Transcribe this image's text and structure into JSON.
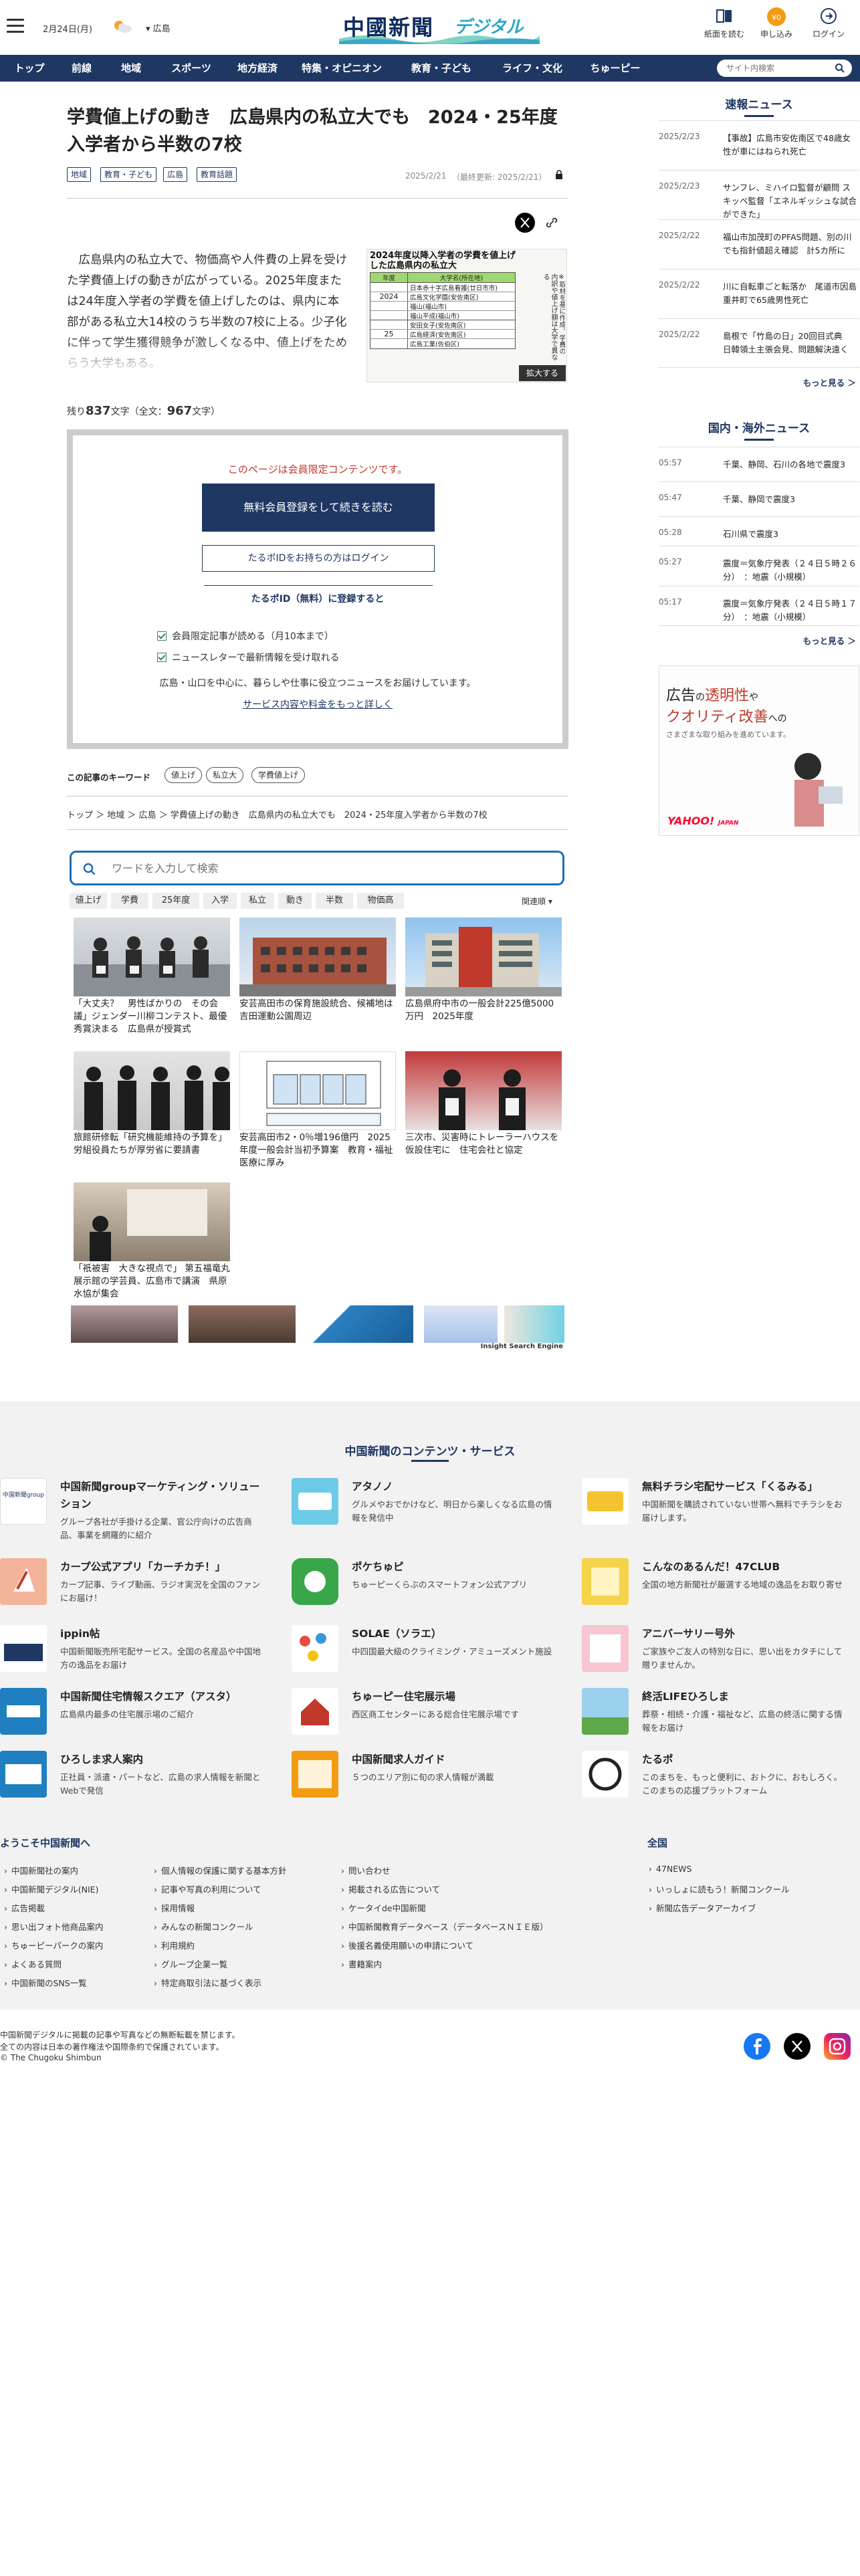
{
  "header": {
    "date": "2月24日(月)",
    "region": "広島",
    "logo_main": "中國新聞",
    "logo_sub": "デジタル",
    "icons": [
      {
        "label": "紙面を読む",
        "icon": "newspaper-icon"
      },
      {
        "label": "申し込み",
        "icon": "apply-badge-icon"
      },
      {
        "label": "ログイン",
        "icon": "login-icon"
      }
    ]
  },
  "nav": {
    "items": [
      "トップ",
      "前線",
      "地域",
      "スポーツ",
      "地方経済",
      "特集・オピニオン",
      "教育・子ども",
      "ライフ・文化",
      "ちゅーピー"
    ],
    "search_placeholder": "サイト内検索"
  },
  "article": {
    "title": "学費値上げの動き　広島県内の私立大でも　2024・25年度入学者から半数の7校",
    "tags": [
      "地域",
      "教育・子ども",
      "広島",
      "教育話題"
    ],
    "date": "2025/2/21",
    "updated": "（最終更新: 2025/2/21）",
    "body": "広島県内の私立大で、物価高や人件費の上昇を受けた学費値上げの動きが広がっている。2025年度または24年度入学者の学費を値上げしたのは、県内に本部がある私立大14校のうち半数の7校に上る。少子化に伴って学生獲得競争が激しくなる中、値上げをためらう大学もある。",
    "remaining_prefix": "残り",
    "remaining_count": "837",
    "remaining_mid": "文字（全文：",
    "total_count": "967",
    "remaining_suffix": "文字）",
    "figure": {
      "title": "2024年度以降入学者の学費を値上げした広島県内の私立大",
      "col_year": "年度",
      "col_univ": "大学名(所在地)",
      "rows": [
        {
          "year": "",
          "univ": "日本赤十字広島看護(廿日市市)"
        },
        {
          "year": "2024",
          "univ": "広島文化学園(安佐南区)"
        },
        {
          "year": "",
          "univ": "福山(福山市)"
        },
        {
          "year": "",
          "univ": "福山平成(福山市)"
        },
        {
          "year": "",
          "univ": "安田女子(安佐南区)"
        },
        {
          "year": "25",
          "univ": "広島経済(安佐南区)"
        },
        {
          "year": "",
          "univ": "広島工業(佐伯区)"
        }
      ],
      "side_note": "※取材を基に作成。学費の内訳や値上げ額は大学で異なる",
      "zoom_label": "拡大する"
    }
  },
  "paywall": {
    "message": "このページは会員限定コンテンツです。",
    "free_button": "無料会員登録をして続きを読む",
    "login_button": "たるポIDをお持ちの方はログイン",
    "register_heading": "たるポID（無料）に登録すると",
    "benefits": [
      "会員限定記事が読める（月10本まで）",
      "ニュースレターで最新情報を受け取れる"
    ],
    "news_line": "広島・山口を中心に、暮らしや仕事に役立つニュースをお届けしています。",
    "more_link": "サービス内容や料金をもっと詳しく"
  },
  "keywords": {
    "label": "この記事のキーワード",
    "items": [
      "値上げ",
      "私立大",
      "学費値上げ"
    ]
  },
  "breadcrumb": "トップ ＞ 地域 ＞ 広島 ＞ 学費値上げの動き　広島県内の私立大でも　2024・25年度入学者から半数の7校",
  "ise": {
    "placeholder": "ワードを入力して検索",
    "word_tabs": [
      "値上げ",
      "学費",
      "25年度",
      "入学",
      "私立",
      "動き",
      "半数",
      "物価高"
    ],
    "sort_label": "関連順",
    "cards": [
      {
        "caption": "「大丈夫？　男性ばかりの　その会議」ジェンダー川柳コンテスト、最優秀賞決まる　広島県が授賞式"
      },
      {
        "caption": "安芸高田市の保育施設統合、候補地は吉田運動公園周辺"
      },
      {
        "caption": "広島県府中市の一般会計225億5000万円　2025年度"
      },
      {
        "caption": "旅館研修転「研究機能維持の予算を」 労組役員たちが厚労省に要請書"
      },
      {
        "caption": "安芸高田市2・0％増196億円　2025年度一般会計当初予算案　教育・福祉医療に厚み"
      },
      {
        "caption": "三次市、災害時にトレーラーハウスを仮設住宅に　住宅会社と協定"
      },
      {
        "caption": "「祇被害　大きな視点で」 第五福竜丸展示館の学芸員、広島市で講演　県原水協が集会"
      }
    ],
    "engine_label": "Insight Search Engine"
  },
  "sokuhou": {
    "heading": "速報ニュース",
    "items": [
      {
        "date": "2025/2/23",
        "title": "【事故】広島市安佐南区で48歳女性が車にはねられ死亡"
      },
      {
        "date": "2025/2/23",
        "title": "サンフレ、ミハイロ監督が顧問 スキッベ監督「エネルギッシュな試合ができた」"
      },
      {
        "date": "2025/2/22",
        "title": "福山市加茂町のPFAS問題、別の川でも指針値超え確認　計5カ所に"
      },
      {
        "date": "2025/2/22",
        "title": "川に自転車ごと転落か　尾道市因島重井町で65歳男性死亡"
      },
      {
        "date": "2025/2/22",
        "title": "島根で「竹島の日」20回目式典　日韓領土主張会見、問題解決遠く"
      }
    ],
    "more": "もっと見る ＞"
  },
  "kokunai": {
    "heading": "国内・海外ニュース",
    "items": [
      {
        "time": "05:57",
        "title": "千葉、静岡、石川の各地で震度3"
      },
      {
        "time": "05:47",
        "title": "千葉、静岡で震度3"
      },
      {
        "time": "05:28",
        "title": "石川県で震度3"
      },
      {
        "time": "05:27",
        "title": "震度＝気象庁発表（２４日５時２６分）　：地震（小規模）"
      },
      {
        "time": "05:17",
        "title": "震度＝気象庁発表（２４日５時１７分）　：地震（小規模）"
      }
    ],
    "more": "もっと見る ＞"
  },
  "ad": {
    "line1a": "広告",
    "line1b": "の",
    "line1c": "透明性",
    "line1d": "や",
    "line2a": "クオリティ改善",
    "line2b": "への",
    "line3": "さまざまな取り組みを進めています。",
    "brand": "YAHOO!",
    "brand_sub": "JAPAN"
  },
  "services": {
    "heading": "中国新聞のコンテンツ・サービス",
    "items": [
      {
        "name": "中国新聞groupマーケティング・ソリューション",
        "desc": "グループ各社が手掛ける企業、官公庁向けの広告商品、事業を網羅的に紹介",
        "icon": "marketing-solution-icon"
      },
      {
        "name": "アタノノ",
        "desc": "グルメやおでかけなど、明日から楽しくなる広島の情報を発信中",
        "icon": "atanono-icon"
      },
      {
        "name": "無料チラシ宅配サービス「くるみる」",
        "desc": "中国新聞を購読されていない世帯へ無料でチラシをお届けします。",
        "icon": "kurumiru-icon"
      },
      {
        "name": "カープ公式アプリ「カーチカチ！」",
        "desc": "カープ記事、ライブ動画、ラジオ実況を全国のファンにお届け！",
        "icon": "carp-app-icon"
      },
      {
        "name": "ポケちゅピ",
        "desc": "ちゅーピーくらぶのスマートフォン公式アプリ",
        "icon": "pokechupi-icon"
      },
      {
        "name": "こんなのあるんだ！47CLUB",
        "desc": "全国の地方新聞社が厳選する地域の逸品をお取り寄せ",
        "icon": "47club-icon"
      },
      {
        "name": "ippin帖",
        "desc": "中国新聞販売所宅配サービス。全国の名産品や中国地方の逸品をお届け",
        "icon": "ippincho-icon"
      },
      {
        "name": "SOLAE（ソラエ）",
        "desc": "中四国最大級のクライミング・アミューズメント施設",
        "icon": "solae-icon"
      },
      {
        "name": "アニバーサリー号外",
        "desc": "ご家族やご友人の特別な日に、思い出をカタチにして贈りませんか。",
        "icon": "anniversary-icon"
      },
      {
        "name": "中国新聞住宅情報スクエア（アスタ）",
        "desc": "広島県内最多の住宅展示場のご紹介",
        "icon": "asta-icon"
      },
      {
        "name": "ちゅーピー住宅展示場",
        "desc": "西区商工センターにある総合住宅展示場です",
        "icon": "chupy-house-icon"
      },
      {
        "name": "終活LIFEひろしま",
        "desc": "葬祭・相続・介護・福祉など、広島の終活に関する情報をお届け",
        "icon": "shukatsu-icon"
      },
      {
        "name": "ひろしま求人案内",
        "desc": "正社員・派遣・パートなど、広島の求人情報を新聞とWebで発信",
        "icon": "kyujin-icon"
      },
      {
        "name": "中国新聞求人ガイド",
        "desc": "５つのエリア別に旬の求人情報が満載",
        "icon": "kyujin-guide-icon"
      },
      {
        "name": "たるポ",
        "desc": "このまちを、もっと便利に、おトクに、おもしろく。このまちの応援プラットフォーム",
        "icon": "tarupo-icon"
      }
    ]
  },
  "footer": {
    "welcome": "ようこそ中国新聞へ",
    "zenkoku": "全国",
    "col1": [
      "中国新聞社の案内",
      "中国新聞デジタル(NIE)",
      "広告掲載",
      "思い出フォト他商品案内",
      "ちゅーピーパークの案内",
      "よくある質問",
      "中国新聞のSNS一覧"
    ],
    "col2": [
      "個人情報の保護に関する基本方針",
      "記事や写真の利用について",
      "採用情報",
      "みんなの新聞コンクール",
      "利用規約",
      "グループ企業一覧",
      "特定商取引法に基づく表示"
    ],
    "col3": [
      "問い合わせ",
      "掲載される広告について",
      "ケータイde中国新聞",
      "中国新聞教育データベース（データベースＮＩＥ版）",
      "後援名義使用願いの申請について",
      "書籍案内"
    ],
    "col4": [
      "47NEWS",
      "いっしょに読もう！新聞コンクール",
      "新聞広告データアーカイブ"
    ],
    "copy1": "中国新聞デジタルに掲載の記事や写真などの無断転載を禁じます。",
    "copy2": "全ての内容は日本の著作権法や国際条約で保護されています。",
    "copy3": "© The Chugoku Shimbun"
  },
  "colors": {
    "navy": "#1f3763",
    "accent_red": "#c0392b",
    "badge_orange": "#f39c12"
  }
}
